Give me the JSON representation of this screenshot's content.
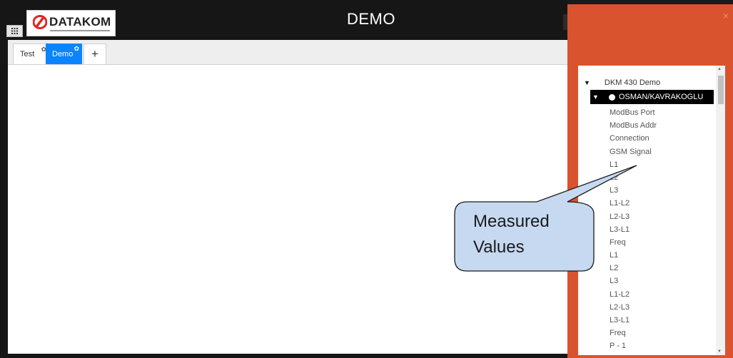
{
  "app": {
    "title": "DEMO",
    "logo_text": "DATAKOM"
  },
  "tabs": [
    {
      "label": "Test",
      "active": false,
      "icon": "gear-icon"
    },
    {
      "label": "Demo",
      "active": true,
      "icon": "gear-icon"
    }
  ],
  "add_tab_label": "+",
  "panel": {
    "close_label": "×",
    "tree": {
      "root_label": "DKM 430 Demo",
      "device_label": "OSMAN/KAVRAKOGLU",
      "items": [
        "ModBus Port",
        "ModBus Addr",
        "Connection",
        "GSM Signal",
        "L1",
        "L2",
        "L3",
        "L1-L2",
        "L2-L3",
        "L3-L1",
        "Freq",
        "L1",
        "L2",
        "L3",
        "L1-L2",
        "L2-L3",
        "L3-L1",
        "Freq",
        "P - 1"
      ]
    }
  },
  "callout": {
    "line1": "Measured",
    "line2": "Values"
  },
  "colors": {
    "panel": "#d9532e",
    "active_tab": "#0a84ff",
    "callout_fill": "#c6d9f1"
  }
}
